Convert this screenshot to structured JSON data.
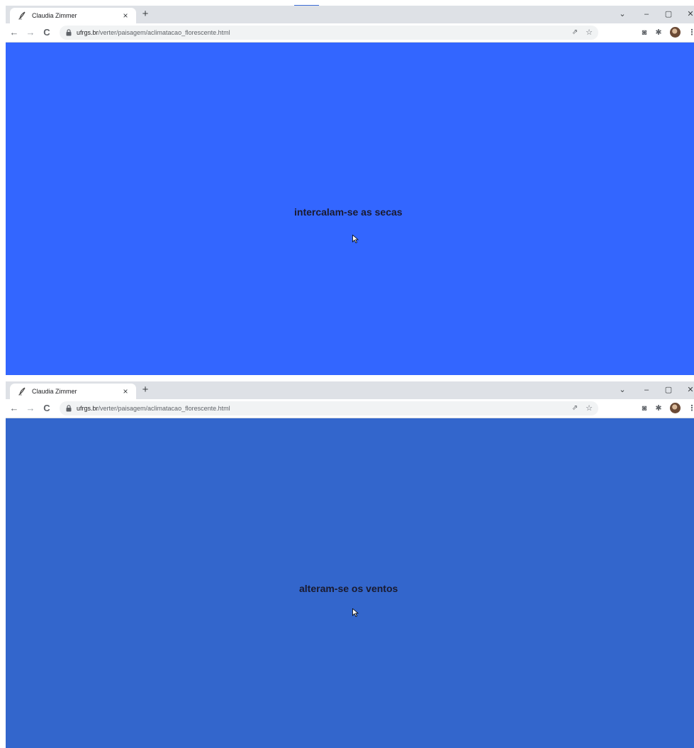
{
  "screens": [
    {
      "tab": {
        "title": "Claudia Zimmer",
        "close_label": "×"
      },
      "new_tab_label": "+",
      "window_controls": {
        "dropdown": "⌄",
        "minimize": "–",
        "restore": "▢",
        "close": "✕"
      },
      "nav": {
        "back": "←",
        "forward": "→",
        "reload": "C"
      },
      "address": {
        "host": "ufrgs.br",
        "path": "/verter/paisagem/aclimatacao_florescente.html"
      },
      "toolbar": {
        "share": "⇗",
        "bookmark": "☆",
        "screenshot": "◙",
        "extensions": "✱",
        "menu": "⋮"
      },
      "page": {
        "background": "#3366ff",
        "message": "intercalam-se as secas"
      }
    },
    {
      "tab": {
        "title": "Claudia Zimmer",
        "close_label": "×"
      },
      "new_tab_label": "+",
      "window_controls": {
        "dropdown": "⌄",
        "minimize": "–",
        "restore": "▢",
        "close": "✕"
      },
      "nav": {
        "back": "←",
        "forward": "→",
        "reload": "C"
      },
      "address": {
        "host": "ufrgs.br",
        "path": "/verter/paisagem/aclimatacao_florescente.html"
      },
      "toolbar": {
        "share": "⇗",
        "bookmark": "☆",
        "screenshot": "◙",
        "extensions": "✱",
        "menu": "⋮"
      },
      "page": {
        "background": "#3366cc",
        "message": "alteram-se os ventos"
      }
    }
  ],
  "icons": {
    "favicon": "quill-favicon-icon",
    "lock": "lock-icon",
    "cursor": "mouse-pointer-icon",
    "avatar": "profile-avatar"
  }
}
